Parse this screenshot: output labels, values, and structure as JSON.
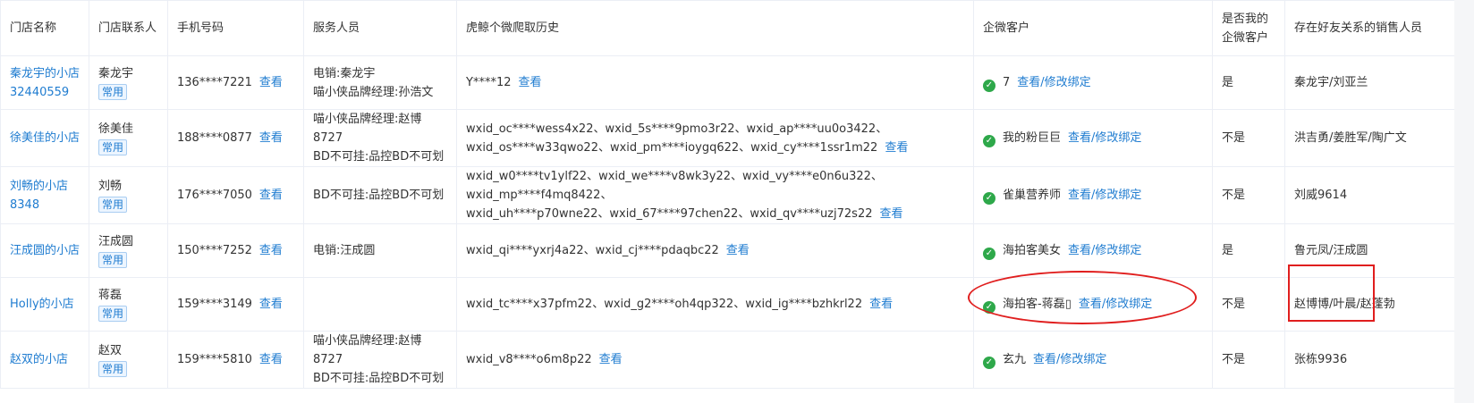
{
  "colors": {
    "link": "#1f7cd0",
    "check": "#2ea84a",
    "annotation": "#e01e1e",
    "tag_bg": "#ecf5ff"
  },
  "icons": {
    "verified": "check-circle-icon"
  },
  "table": {
    "headers": [
      "门店名称",
      "门店联系人",
      "手机号码",
      "服务人员",
      "虎鲸个微爬取历史",
      "企微客户",
      "是否我的企微客户",
      "存在好友关系的销售人员"
    ],
    "rows": [
      {
        "store": "秦龙宇的小店32440559",
        "contact": "秦龙宇",
        "tag": "常用",
        "phone": "136****7221",
        "phone_link": "查看",
        "service": [
          "电销:秦龙宇",
          "喵小侠品牌经理:孙浩文"
        ],
        "history": [
          "Y****12"
        ],
        "history_link": "查看",
        "wecom_name": "7",
        "wecom_link": "查看/修改绑定",
        "is_mine": "是",
        "sales": "秦龙宇/刘亚兰"
      },
      {
        "store": "徐美佳的小店",
        "contact": "徐美佳",
        "tag": "常用",
        "phone": "188****0877",
        "phone_link": "查看",
        "service": [
          "喵小侠品牌经理:赵博8727",
          "BD不可挂:品控BD不可划"
        ],
        "history": [
          "wxid_oc****wess4x22、wxid_5s****9pmo3r22、wxid_ap****uu0o3422、",
          "wxid_os****w33qwo22、wxid_pm****ioygq622、wxid_cy****1ssr1m22"
        ],
        "history_link": "查看",
        "wecom_name": "我的粉巨巨",
        "wecom_link": "查看/修改绑定",
        "is_mine": "不是",
        "sales": "洪吉勇/姜胜军/陶广文"
      },
      {
        "store": "刘畅的小店8348",
        "contact": "刘畅",
        "tag": "常用",
        "phone": "176****7050",
        "phone_link": "查看",
        "service": [
          "BD不可挂:品控BD不可划"
        ],
        "history": [
          "wxid_w0****tv1ylf22、wxid_we****v8wk3y22、wxid_vy****e0n6u322、wxid_mp****f4mq8422、",
          "wxid_uh****p70wne22、wxid_67****97chen22、wxid_qv****uzj72s22"
        ],
        "history_link": "查看",
        "wecom_name": "雀巢营养师",
        "wecom_link": "查看/修改绑定",
        "is_mine": "不是",
        "sales": "刘威9614"
      },
      {
        "store": "汪成圆的小店",
        "contact": "汪成圆",
        "tag": "常用",
        "phone": "150****7252",
        "phone_link": "查看",
        "service": [
          "电销:汪成圆"
        ],
        "history": [
          "wxid_qi****yxrj4a22、wxid_cj****pdaqbc22"
        ],
        "history_link": "查看",
        "wecom_name": "海拍客美女",
        "wecom_link": "查看/修改绑定",
        "is_mine": "是",
        "sales": "鲁元凤/汪成圆"
      },
      {
        "store": "Holly的小店",
        "contact": "蒋磊",
        "tag": "常用",
        "phone": "159****3149",
        "phone_link": "查看",
        "service": [],
        "history": [
          "wxid_tc****x37pfm22、wxid_g2****oh4qp322、wxid_ig****bzhkrl22"
        ],
        "history_link": "查看",
        "wecom_name": "海拍客-蒋磊▯",
        "wecom_link": "查看/修改绑定",
        "is_mine": "不是",
        "sales": "赵博博/叶晨/赵蓬勃"
      },
      {
        "store": "赵双的小店",
        "contact": "赵双",
        "tag": "常用",
        "phone": "159****5810",
        "phone_link": "查看",
        "service": [
          "喵小侠品牌经理:赵博8727",
          "BD不可挂:品控BD不可划"
        ],
        "history": [
          "wxid_v8****o6m8p22"
        ],
        "history_link": "查看",
        "wecom_name": "玄九",
        "wecom_link": "查看/修改绑定",
        "is_mine": "不是",
        "sales": "张栋9936"
      }
    ]
  }
}
